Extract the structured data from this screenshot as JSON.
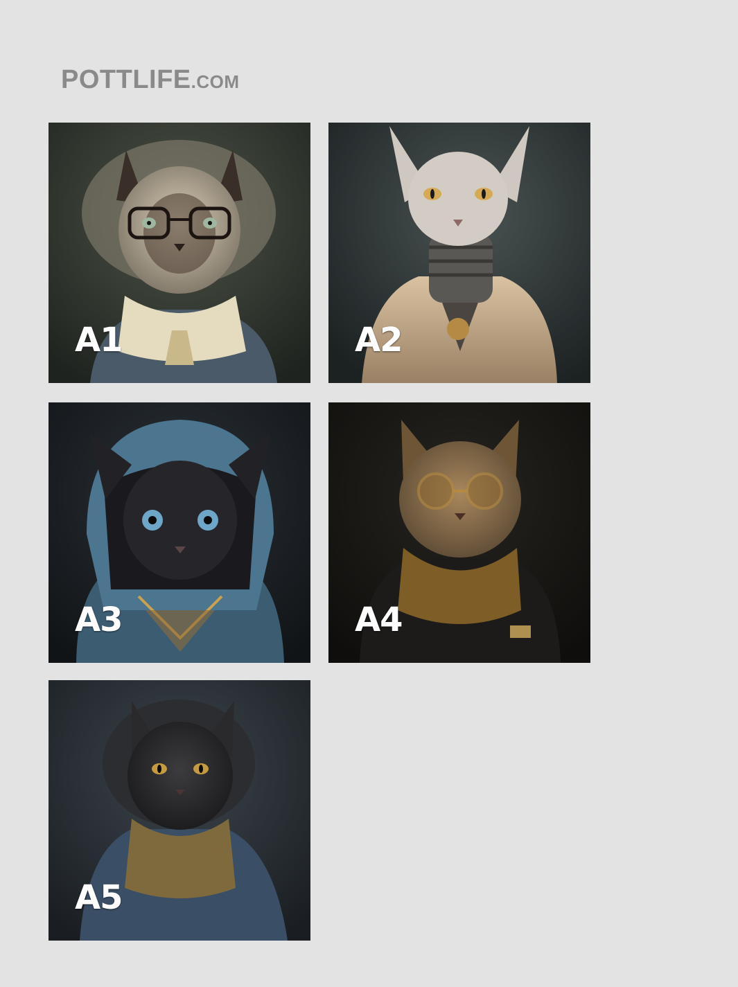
{
  "brand": {
    "main": "POTTLIFE",
    "tld": ".COM",
    "color": "#8a8a8a"
  },
  "tiles": [
    {
      "label": "A1",
      "image": "cat-portrait-glasses-scarf"
    },
    {
      "label": "A2",
      "image": "sphynx-cat-trench-coat"
    },
    {
      "label": "A3",
      "image": "black-cat-denim-hoodie"
    },
    {
      "label": "A4",
      "image": "tabby-cat-round-glasses-leather-jacket"
    },
    {
      "label": "A5",
      "image": "fluffy-black-cat-denim-jacket"
    }
  ]
}
